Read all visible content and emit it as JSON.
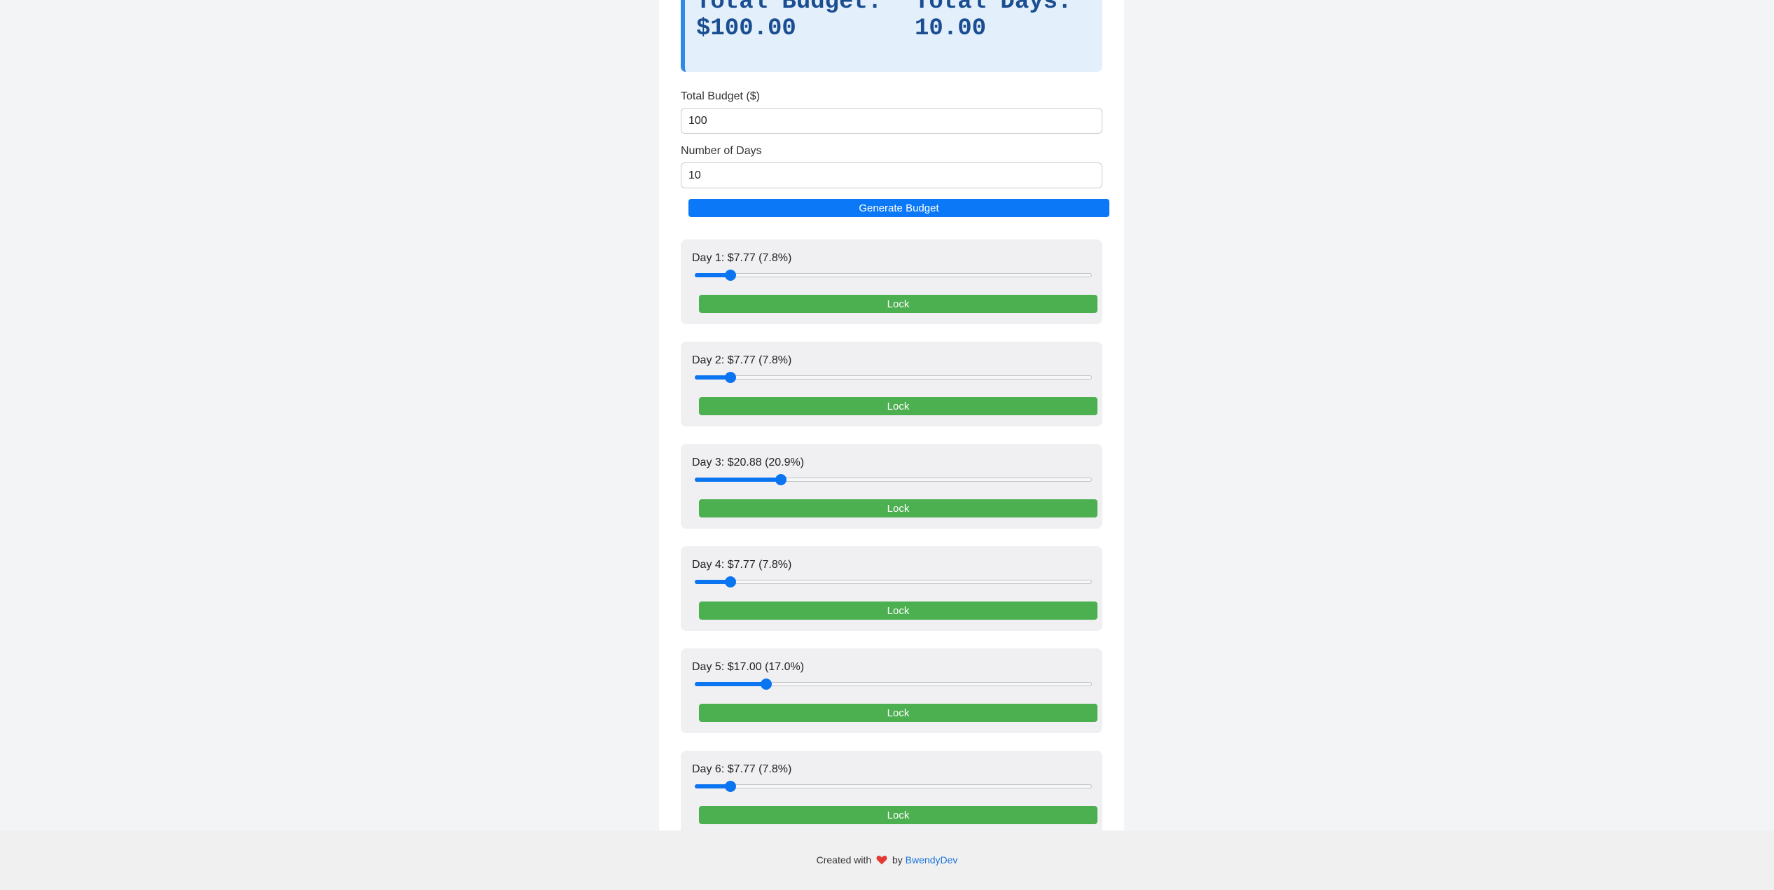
{
  "summary": {
    "budget_label": "Total Budget:",
    "budget_value": "$100.00",
    "days_label": "Total Days:",
    "days_value": "10.00"
  },
  "form": {
    "budget_label": "Total Budget ($)",
    "budget_value": "100",
    "days_label": "Number of Days",
    "days_value": "10",
    "generate_label": "Generate Budget"
  },
  "days": [
    {
      "label": "Day 1: $7.77 (7.8%)",
      "percent": 7.8,
      "lock_label": "Lock"
    },
    {
      "label": "Day 2: $7.77 (7.8%)",
      "percent": 7.8,
      "lock_label": "Lock"
    },
    {
      "label": "Day 3: $20.88 (20.9%)",
      "percent": 20.9,
      "lock_label": "Lock"
    },
    {
      "label": "Day 4: $7.77 (7.8%)",
      "percent": 7.8,
      "lock_label": "Lock"
    },
    {
      "label": "Day 5: $17.00 (17.0%)",
      "percent": 17.0,
      "lock_label": "Lock"
    },
    {
      "label": "Day 6: $7.77 (7.8%)",
      "percent": 7.8,
      "lock_label": "Lock"
    }
  ],
  "footer": {
    "created_with": "Created with",
    "heart_icon": "heart-icon",
    "by": "by",
    "author_link": "BwendyDev",
    "heart_color": "#e53935"
  },
  "colors": {
    "primary": "#0b79f7",
    "lock_button": "#4caf50",
    "summary_bg": "#e3f0fc",
    "summary_text": "#1a4e91"
  }
}
